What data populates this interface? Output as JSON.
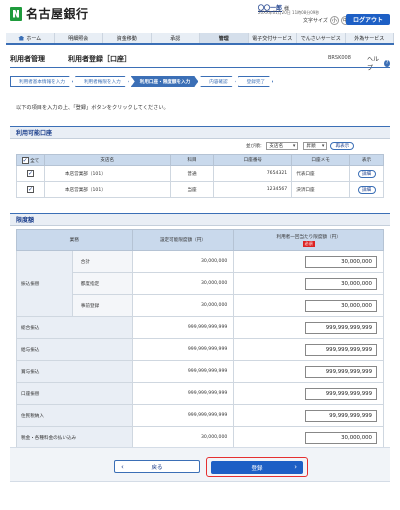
{
  "header": {
    "bank_name": "名古屋銀行",
    "user_name": "〇〇一郎",
    "user_suffix": "様",
    "last_login": "20XX年01月20日 11時08分09秒",
    "font_size_label": "文字サイズ",
    "font_sizes": [
      "小",
      "中",
      "大"
    ],
    "active_font_size": "大",
    "logout_label": "ログアウト"
  },
  "nav": {
    "items": [
      "ホーム",
      "明細照会",
      "資金移動",
      "承認",
      "管理",
      "電子交付サービス",
      "でんさいサービス",
      "外為サービス"
    ],
    "active": "管理"
  },
  "page": {
    "title_main": "利用者管理",
    "title_sub": "利用者登録［口座］",
    "screen_id": "BRSK008",
    "help_label": "ヘルプ",
    "help_icon": "?"
  },
  "steps": [
    "利用者基本情報を入力",
    "利用者権限を入力",
    "利用口座・限度額を入力",
    "内容確認",
    "登録完了"
  ],
  "current_step": 2,
  "instruction": "以下の項目を入力の上、「登録」ボタンをクリックしてください。",
  "accounts_section": {
    "title": "利用可能口座",
    "sort_label": "並び順：",
    "sort_value": "支店名",
    "order_value": "昇順",
    "resort_label": "再表示",
    "columns": [
      "全て",
      "支店名",
      "科目",
      "口座番号",
      "口座メモ",
      "表示"
    ],
    "rows": [
      {
        "checked": true,
        "branch": "本店営業部（101）",
        "subject": "普通",
        "number": "7654321",
        "memo": "代表口座",
        "action": "詳細"
      },
      {
        "checked": true,
        "branch": "本店営業部（101）",
        "subject": "当座",
        "number": "1234567",
        "memo": "決済口座",
        "action": "詳細"
      }
    ]
  },
  "limits_section": {
    "title": "限度額",
    "columns": [
      "業務",
      "設定可能限度額（円）",
      "利用者一回当たり限度額（円）"
    ],
    "required": "必須",
    "transfer_group": "振込振替",
    "rows": [
      {
        "label": "合計",
        "max": "30,000,000",
        "value": "30,000,000"
      },
      {
        "label": "都度指定",
        "max": "30,000,000",
        "value": "30,000,000"
      },
      {
        "label": "事前登録",
        "max": "30,000,000",
        "value": "30,000,000"
      },
      {
        "label": "総合振込",
        "max": "999,999,999,999",
        "value": "999,999,999,999"
      },
      {
        "label": "給与振込",
        "max": "999,999,999,999",
        "value": "999,999,999,999"
      },
      {
        "label": "賞与振込",
        "max": "999,999,999,999",
        "value": "999,999,999,999"
      },
      {
        "label": "口座振替",
        "max": "999,999,999,999",
        "value": "999,999,999,999"
      },
      {
        "label": "住民税納入",
        "max": "999,999,999,999",
        "value": "99,999,999,999"
      },
      {
        "label": "税金・各種料金の払い込み",
        "max": "30,000,000",
        "value": "30,000,000"
      }
    ]
  },
  "buttons": {
    "back": "戻る",
    "register": "登録"
  },
  "colors": {
    "accent": "#1d5fc5",
    "brand_green": "#1e9b3c",
    "highlight": "#e53030"
  }
}
